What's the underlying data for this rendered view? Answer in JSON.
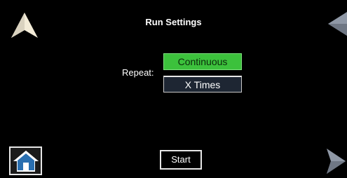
{
  "screen": {
    "title": "Run Settings",
    "repeat_label": "Repeat:",
    "options": [
      {
        "label": "Continuous",
        "selected": true
      },
      {
        "label": "X Times",
        "selected": false
      }
    ],
    "start_label": "Start"
  },
  "icons": {
    "nav_up": "arrow-up-icon",
    "nav_left": "arrow-left-icon",
    "nav_right": "arrow-right-icon",
    "home": "home-icon"
  },
  "colors": {
    "background": "#000000",
    "selected_option": "#3cc13c",
    "unselected_option": "#1e2633",
    "text": "#ffffff"
  }
}
